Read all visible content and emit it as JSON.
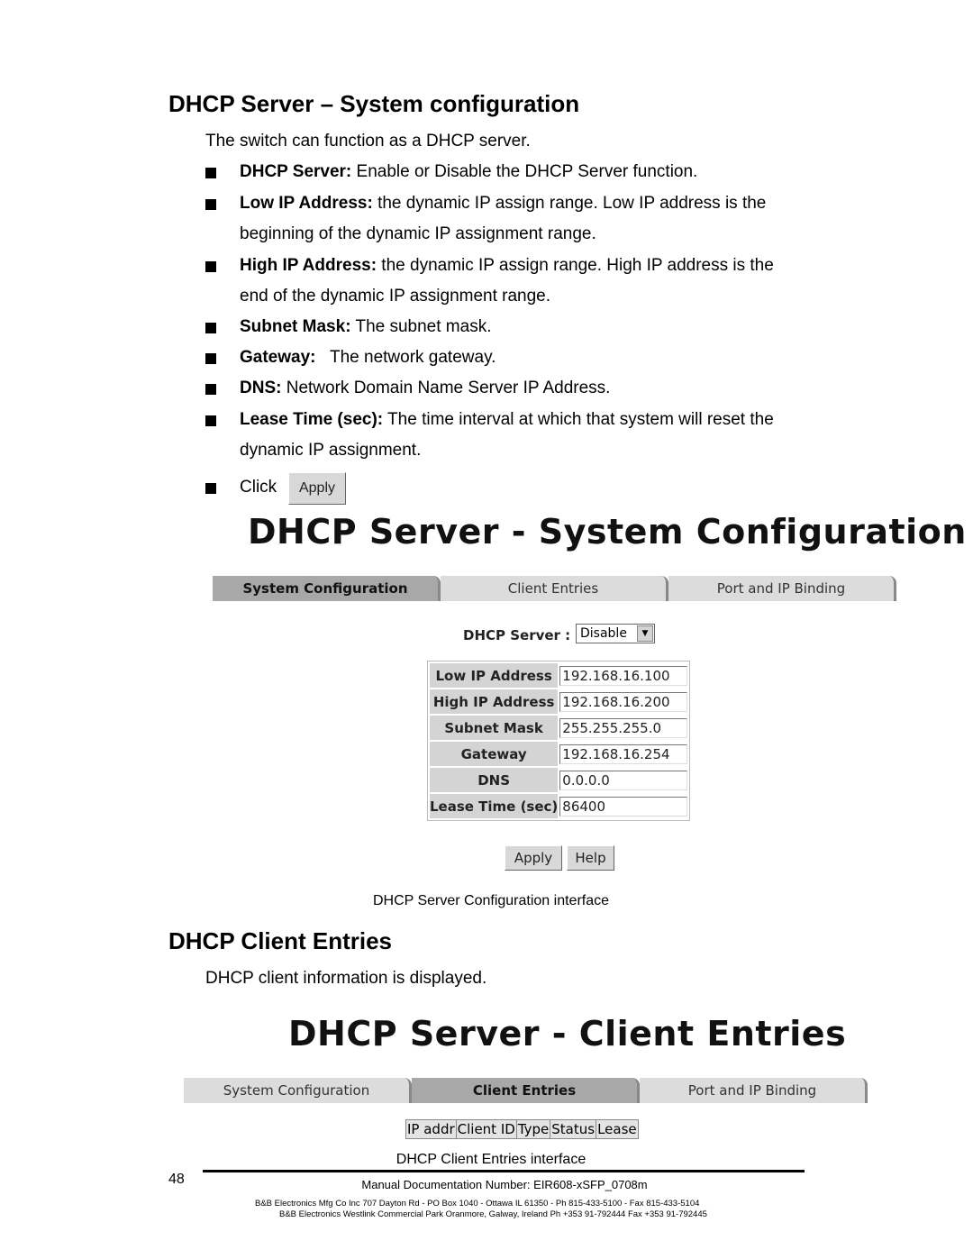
{
  "section1": {
    "title": "DHCP Server – System configuration",
    "intro": "The switch can function as a DHCP server.",
    "bullets": [
      {
        "term": "DHCP Server:",
        "text": " Enable or Disable the DHCP Server function."
      },
      {
        "term": "Low IP Address:",
        "text": " the dynamic IP assign range. Low IP address is the",
        "cont": "beginning of the dynamic IP assignment range."
      },
      {
        "term": "High IP Address:",
        "text": " the dynamic IP assign range. High IP address is the",
        "cont": "end of the dynamic IP assignment range."
      },
      {
        "term": "Subnet Mask:",
        "text": " The subnet mask."
      },
      {
        "term": "Gateway:",
        "text": "   The network gateway."
      },
      {
        "term": "DNS:",
        "text": " Network Domain Name Server IP Address."
      },
      {
        "term": "Lease Time (sec):",
        "text": " The time interval at which that system will reset the",
        "cont": "dynamic IP assignment."
      }
    ],
    "click": "Click",
    "click_button": "Apply"
  },
  "shot1": {
    "title": "DHCP Server - System Configuration",
    "tabs": [
      "System Configuration",
      "Client Entries",
      "Port and IP Binding"
    ],
    "dhcp_label": "DHCP Server :",
    "dhcp_value": "Disable",
    "fields": [
      {
        "label": "Low IP Address",
        "value": "192.168.16.100"
      },
      {
        "label": "High IP Address",
        "value": "192.168.16.200"
      },
      {
        "label": "Subnet Mask",
        "value": "255.255.255.0"
      },
      {
        "label": "Gateway",
        "value": "192.168.16.254"
      },
      {
        "label": "DNS",
        "value": "0.0.0.0"
      },
      {
        "label": "Lease Time (sec)",
        "value": "86400"
      }
    ],
    "apply": "Apply",
    "help": "Help",
    "caption": "DHCP Server Configuration interface"
  },
  "section2": {
    "title": "DHCP Client Entries",
    "intro": "DHCP client information is displayed."
  },
  "shot2": {
    "title": "DHCP Server - Client Entries",
    "tabs": [
      "System Configuration",
      "Client Entries",
      "Port and IP Binding"
    ],
    "columns": [
      "IP addr",
      "Client ID",
      "Type",
      "Status",
      "Lease"
    ],
    "caption": "DHCP Client Entries interface"
  },
  "footer": {
    "page": "48",
    "doc": "Manual Documentation Number: EIR608-xSFP_0708m",
    "line1": "B&B Electronics Mfg Co Inc   707 Dayton Rd - PO Box 1040 - Ottawa IL 61350 - Ph 815-433-5100 - Fax 815-433-5104",
    "line2": "B&B Electronics   Westlink Commercial Park   Oranmore, Galway, Ireland   Ph +353 91-792444   Fax +353 91-792445"
  }
}
